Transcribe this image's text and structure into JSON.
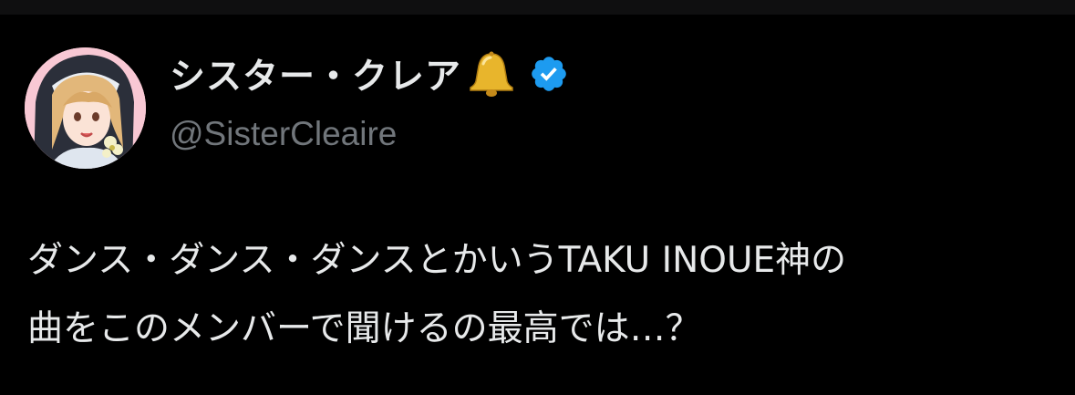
{
  "author": {
    "display_name": "シスター・クレア",
    "handle": "@SisterCleaire",
    "name_emoji_icon": "bell-icon",
    "verified_icon": "verified-badge-icon",
    "avatar_icon": "profile-avatar"
  },
  "tweet": {
    "lines": [
      "ダンス・ダンス・ダンスとかいうTAKU INOUE神の",
      "曲をこのメンバーで聞けるの最高では…？"
    ]
  },
  "colors": {
    "background": "#000000",
    "text_primary": "#e7e9ea",
    "text_secondary": "#71767b",
    "verified_blue": "#1d9bf0",
    "bell_gold": "#e8b52c"
  }
}
